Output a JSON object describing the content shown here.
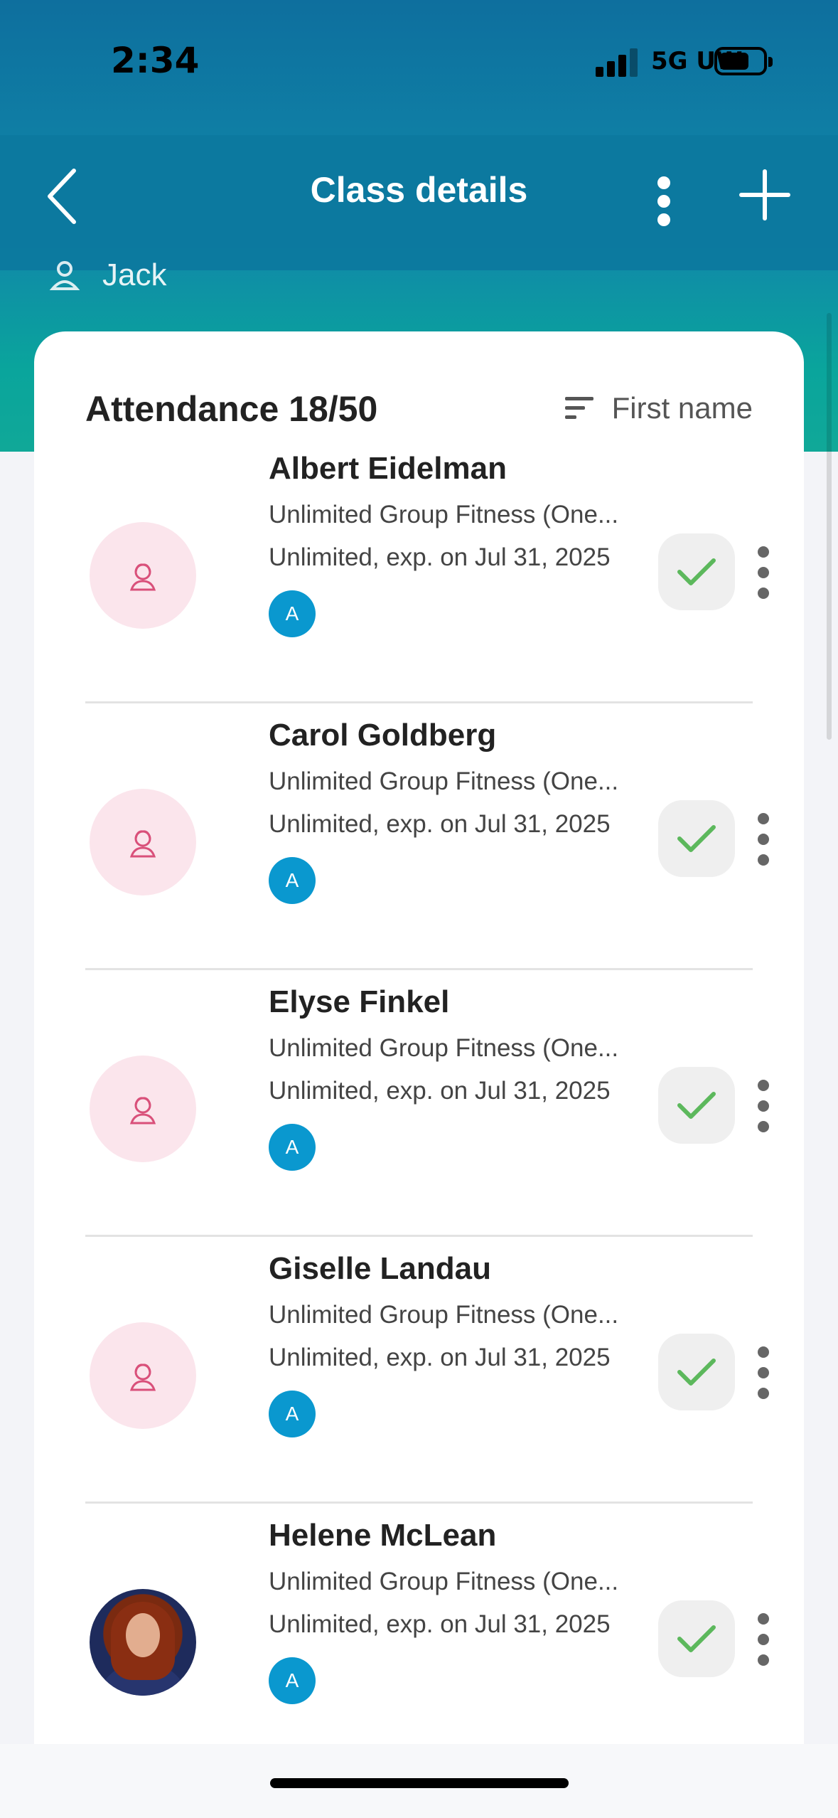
{
  "status_bar": {
    "time": "2:34",
    "network": "5G UW"
  },
  "nav": {
    "title": "Class details"
  },
  "instructor": {
    "name": "Jack"
  },
  "attendance": {
    "title": "Attendance 18/50",
    "sort_label": "First name"
  },
  "attendees": [
    {
      "name": "Albert Eidelman",
      "plan": "Unlimited Group Fitness (One...",
      "expiry": "Unlimited, exp. on Jul 31, 2025",
      "badge": "A",
      "checked_in": true,
      "avatar": "placeholder"
    },
    {
      "name": "Carol Goldberg",
      "plan": "Unlimited Group Fitness (One...",
      "expiry": "Unlimited, exp. on Jul 31, 2025",
      "badge": "A",
      "checked_in": true,
      "avatar": "placeholder"
    },
    {
      "name": "Elyse Finkel",
      "plan": "Unlimited Group Fitness (One...",
      "expiry": "Unlimited, exp. on Jul 31, 2025",
      "badge": "A",
      "checked_in": true,
      "avatar": "placeholder"
    },
    {
      "name": "Giselle Landau",
      "plan": "Unlimited Group Fitness (One...",
      "expiry": "Unlimited, exp. on Jul 31, 2025",
      "badge": "A",
      "checked_in": true,
      "avatar": "placeholder"
    },
    {
      "name": "Helene McLean",
      "plan": "Unlimited Group Fitness (One...",
      "expiry": "Unlimited, exp. on Jul 31, 2025",
      "badge": "A",
      "checked_in": true,
      "avatar": "photo"
    }
  ],
  "colors": {
    "header_top": "#0e6f9e",
    "header_bottom": "#10a898",
    "badge": "#0a98cf",
    "check": "#5cb85c",
    "avatar_bg": "#fbe5ec",
    "avatar_icon": "#d9507a"
  }
}
